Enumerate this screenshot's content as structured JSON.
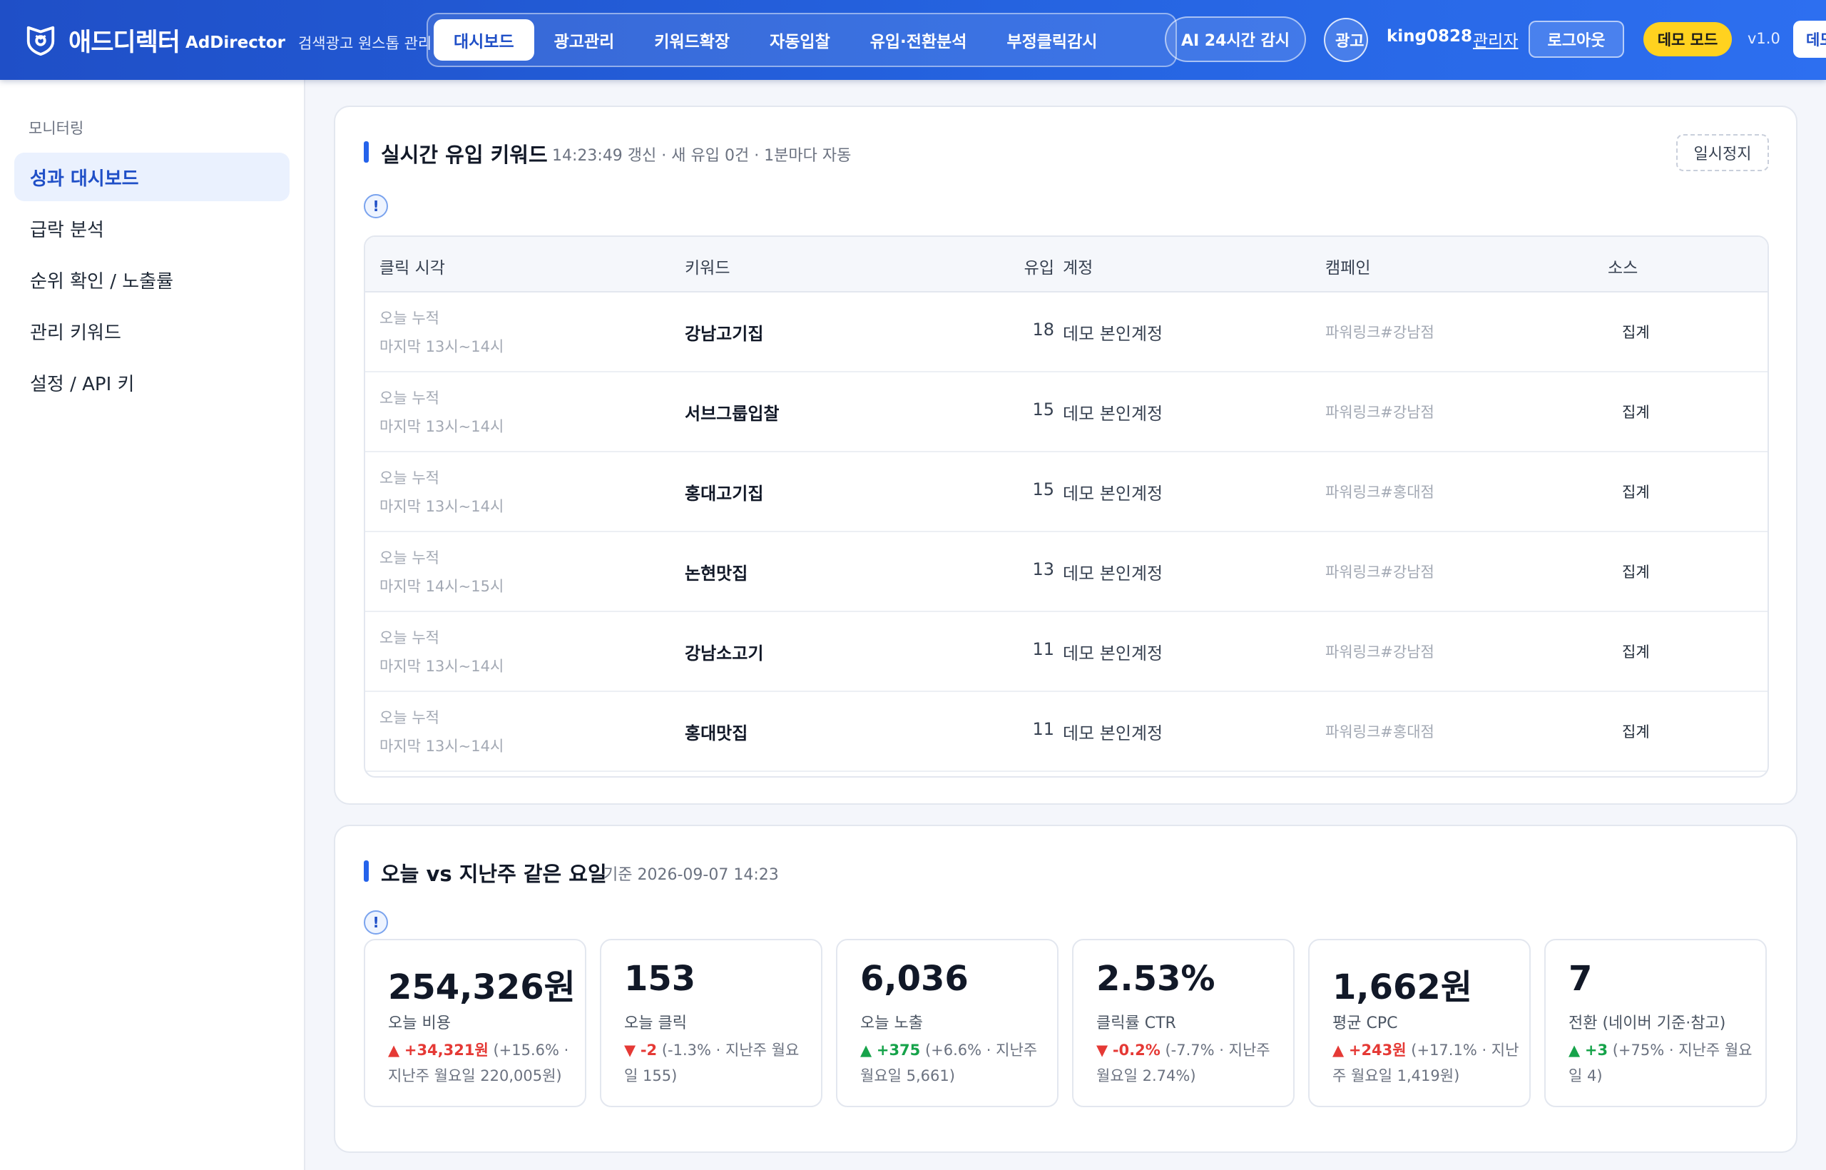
{
  "header": {
    "brand_ko": "애드디렉터",
    "brand_en": "AdDirector",
    "brand_sub": "검색광고 원스톱 관리",
    "nav": [
      "대시보드",
      "광고관리",
      "키워드확장",
      "자동입찰",
      "유입·전환분석",
      "부정클릭감시"
    ],
    "active_nav": "대시보드",
    "ai_button": "AI 24시간 감시",
    "avatar_text": "광고",
    "username": "king0828",
    "role": "관리자",
    "logout": "로그아웃",
    "demo_badge": "데모 모드",
    "version": "v1.0",
    "demo_cut": "데모"
  },
  "sidebar": {
    "section": "모니터링",
    "items": [
      "성과 대시보드",
      "급락 분석",
      "순위 확인 / 노출률",
      "관리 키워드",
      "설정 / API 키"
    ],
    "active": "성과 대시보드"
  },
  "realtime": {
    "title": "실시간 유입 키워드",
    "subtitle": "14:23:49 갱신 · 새 유입 0건 · 1분마다 자동",
    "pause_button": "일시정지",
    "info": "!",
    "columns": [
      "클릭 시각",
      "키워드",
      "유입",
      "계정",
      "캠페인",
      "소스"
    ],
    "rows": [
      {
        "time1": "오늘 누적",
        "time2": "마지막 13시~14시",
        "keyword": "강남고기집",
        "count": "18",
        "account": "데모 본인계정",
        "campaign": "파워링크#강남점",
        "source": "집계"
      },
      {
        "time1": "오늘 누적",
        "time2": "마지막 13시~14시",
        "keyword": "서브그룹입찰",
        "count": "15",
        "account": "데모 본인계정",
        "campaign": "파워링크#강남점",
        "source": "집계"
      },
      {
        "time1": "오늘 누적",
        "time2": "마지막 13시~14시",
        "keyword": "홍대고기집",
        "count": "15",
        "account": "데모 본인계정",
        "campaign": "파워링크#홍대점",
        "source": "집계"
      },
      {
        "time1": "오늘 누적",
        "time2": "마지막 14시~15시",
        "keyword": "논현맛집",
        "count": "13",
        "account": "데모 본인계정",
        "campaign": "파워링크#강남점",
        "source": "집계"
      },
      {
        "time1": "오늘 누적",
        "time2": "마지막 13시~14시",
        "keyword": "강남소고기",
        "count": "11",
        "account": "데모 본인계정",
        "campaign": "파워링크#강남점",
        "source": "집계"
      },
      {
        "time1": "오늘 누적",
        "time2": "마지막 13시~14시",
        "keyword": "홍대맛집",
        "count": "11",
        "account": "데모 본인계정",
        "campaign": "파워링크#홍대점",
        "source": "집계"
      }
    ]
  },
  "compare": {
    "title": "오늘 vs 지난주 같은 요일",
    "subtitle": "기준 2026-09-07 14:23",
    "info": "!",
    "kpis": [
      {
        "value": "254,326원",
        "label": "오늘 비용",
        "arrow": "▲",
        "delta": "+34,321원",
        "dir": "up",
        "note": " (+15.6% · 지난주 월요일 220,005원)"
      },
      {
        "value": "153",
        "label": "오늘 클릭",
        "arrow": "▼",
        "delta": "-2",
        "dir": "down",
        "note": " (-1.3% · 지난주 월요일 155)"
      },
      {
        "value": "6,036",
        "label": "오늘 노출",
        "arrow": "▲",
        "delta": "+375",
        "dir": "good",
        "note": " (+6.6% · 지난주 월요일 5,661)"
      },
      {
        "value": "2.53%",
        "label": "클릭률 CTR",
        "arrow": "▼",
        "delta": "-0.2%",
        "dir": "down",
        "note": " (-7.7% · 지난주 월요일 2.74%)"
      },
      {
        "value": "1,662원",
        "label": "평균 CPC",
        "arrow": "▲",
        "delta": "+243원",
        "dir": "up",
        "note": " (+17.1% · 지난주 월요일 1,419원)"
      },
      {
        "value": "7",
        "label": "전환 (네이버 기준·참고)",
        "arrow": "▲",
        "delta": "+3",
        "dir": "good",
        "note": " (+75% · 지난주 월요일 4)"
      }
    ]
  },
  "colors": {
    "header_blue": "#2563e0",
    "accent": "#1f4fc7",
    "demo_yellow": "#ffd21f",
    "increase_red": "#e53935",
    "increase_green": "#16a34a"
  }
}
